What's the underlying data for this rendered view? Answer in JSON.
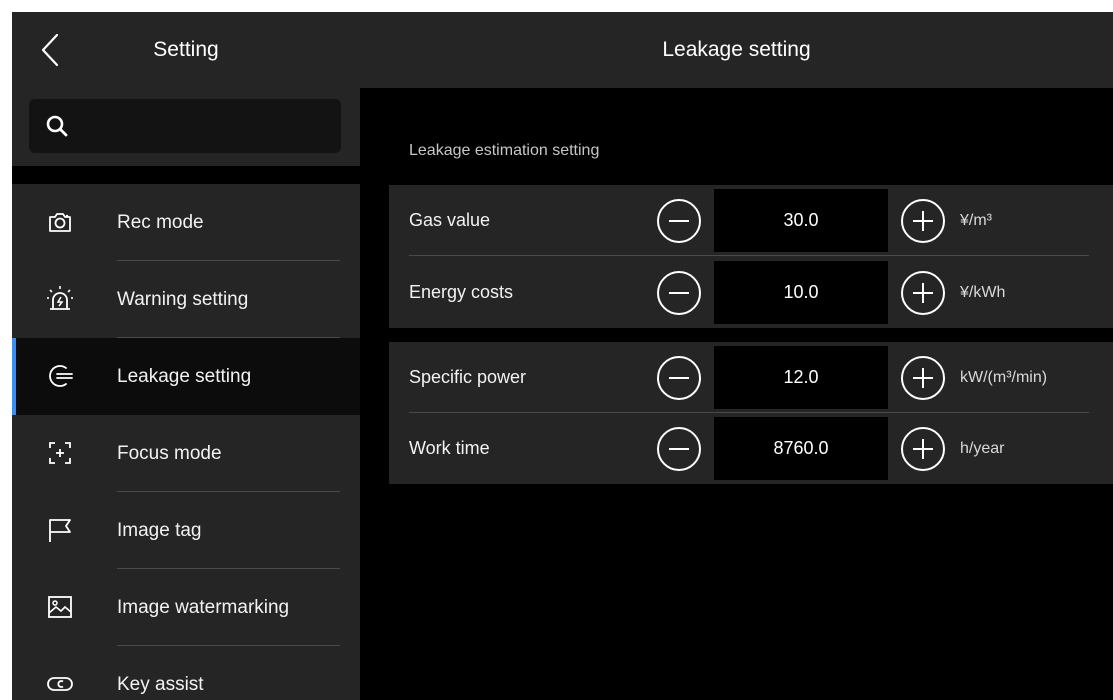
{
  "sidebar": {
    "title": "Setting",
    "search": {
      "placeholder": "",
      "value": ""
    },
    "items": [
      {
        "label": "Rec mode",
        "icon": "camera-icon"
      },
      {
        "label": "Warning setting",
        "icon": "alarm-light-icon"
      },
      {
        "label": "Leakage setting",
        "icon": "leakage-icon",
        "active": true
      },
      {
        "label": "Focus mode",
        "icon": "focus-icon"
      },
      {
        "label": "Image tag",
        "icon": "flag-icon"
      },
      {
        "label": "Image watermarking",
        "icon": "image-icon"
      },
      {
        "label": "Key assist",
        "icon": "key-assist-icon"
      }
    ]
  },
  "main": {
    "title": "Leakage setting",
    "section_title": "Leakage estimation setting",
    "groups": [
      {
        "rows": [
          {
            "label": "Gas value",
            "value": "30.0",
            "unit": "¥/m³"
          },
          {
            "label": "Energy costs",
            "value": "10.0",
            "unit": "¥/kWh"
          }
        ]
      },
      {
        "rows": [
          {
            "label": "Specific power",
            "value": "12.0",
            "unit": "kW/(m³/min)"
          },
          {
            "label": "Work time",
            "value": "8760.0",
            "unit": "h/year"
          }
        ]
      }
    ]
  },
  "colors": {
    "accent": "#3a8ef0",
    "panel": "#252525",
    "background": "#000000"
  }
}
